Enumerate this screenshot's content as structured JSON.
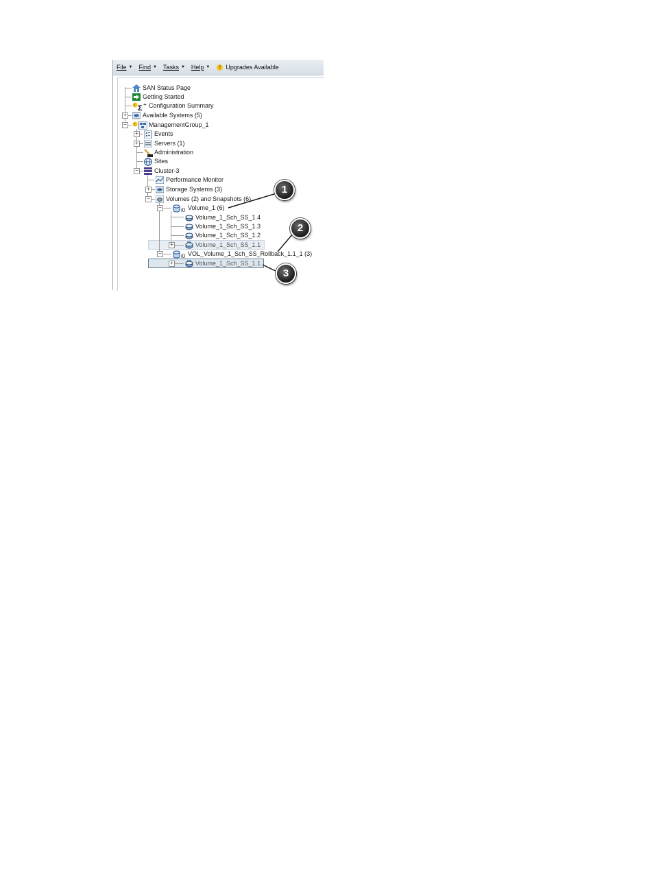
{
  "menubar": {
    "file": "File",
    "find": "Find",
    "tasks": "Tasks",
    "help": "Help",
    "upgrades": "Upgrades Available"
  },
  "tree": {
    "san_status": "SAN Status Page",
    "getting_started": "Getting Started",
    "config_summary": "Configuration Summary",
    "available_systems": "Available Systems (5)",
    "management_group": "ManagementGroup_1",
    "events": "Events",
    "servers": "Servers (1)",
    "administration": "Administration",
    "sites": "Sites",
    "cluster": "Cluster-3",
    "performance_monitor": "Performance Monitor",
    "storage_systems": "Storage Systems (3)",
    "volumes_snapshots": "Volumes (2) and Snapshots (6)",
    "volume_1": "Volume_1 (6)",
    "ss_14": "Volume_1_Sch_SS_1.4",
    "ss_13": "Volume_1_Sch_SS_1.3",
    "ss_12": "Volume_1_Sch_SS_1.2",
    "ss_11": "Volume_1_Sch_SS_1.1",
    "rollback_volume": "VOL_Volume_1_Sch_SS_Rollback_1.1_1 (3)",
    "rollback_snapshot": "Volume_1_Sch_SS_1.1"
  },
  "callouts": [
    "1",
    "2",
    "3"
  ],
  "icons": [
    "home-icon",
    "arrow-icon",
    "sigma-icon",
    "warning-icon",
    "systems-icon",
    "management-group-icon",
    "events-icon",
    "servers-icon",
    "administration-icon",
    "globe-icon",
    "cluster-icon",
    "performance-icon",
    "volume-icon",
    "snapshot-icon",
    "io-icon"
  ]
}
